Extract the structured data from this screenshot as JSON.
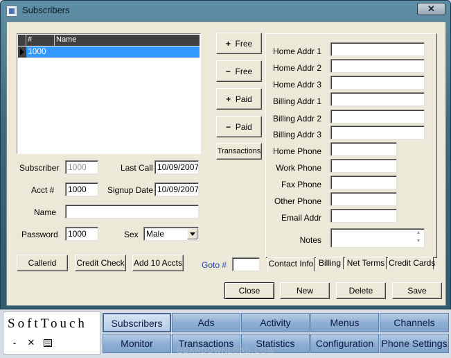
{
  "window": {
    "title": "Subscribers",
    "close_glyph": "✕"
  },
  "grid": {
    "columns": [
      "#",
      "Name"
    ],
    "rows": [
      {
        "num": "1000",
        "name": ""
      }
    ]
  },
  "left_form": {
    "subscriber_label": "Subscriber",
    "subscriber_value": "1000",
    "last_call_label": "Last Call",
    "last_call_value": "10/09/2007",
    "acct_label": "Acct #",
    "acct_value": "1000",
    "signup_label": "Signup Date",
    "signup_value": "10/09/2007",
    "name_label": "Name",
    "name_value": "",
    "password_label": "Password",
    "password_value": "1000",
    "sex_label": "Sex",
    "sex_value": "Male"
  },
  "action_buttons": {
    "callerid": "Callerid",
    "credit_check": "Credit Check",
    "add10": "Add 10 Accts",
    "goto_label": "Goto #",
    "goto_value": ""
  },
  "side_buttons": {
    "plus_free": "Free",
    "minus_free": "Free",
    "plus_paid": "Paid",
    "minus_paid": "Paid",
    "transactions": "Transactions"
  },
  "contact": {
    "home_addr1": "Home Addr 1",
    "home_addr2": "Home Addr 2",
    "home_addr3": "Home Addr 3",
    "billing_addr1": "Billing Addr 1",
    "billing_addr2": "Billing Addr 2",
    "billing_addr3": "Billing Addr 3",
    "home_phone": "Home Phone",
    "work_phone": "Work Phone",
    "fax_phone": "Fax Phone",
    "other_phone": "Other Phone",
    "email_addr": "Email Addr",
    "notes": "Notes"
  },
  "tabs": [
    "Contact Info",
    "Billing",
    "Net Terms",
    "Credit Cards"
  ],
  "footer_buttons": {
    "close": "Close",
    "new": "New",
    "delete": "Delete",
    "save": "Save"
  },
  "app": {
    "logo": "SoftTouch",
    "mini_icons": [
      "minimize-icon",
      "close-icon",
      "properties-icon"
    ],
    "nav_row1": [
      "Subscribers",
      "Ads",
      "Activity",
      "Menus",
      "Channels"
    ],
    "nav_row2": [
      "Monitor",
      "Transactions",
      "Statistics",
      "Configuration",
      "Phone Settings"
    ],
    "active": "Subscribers"
  },
  "watermark": "GEARDOWNLOAD.COM"
}
